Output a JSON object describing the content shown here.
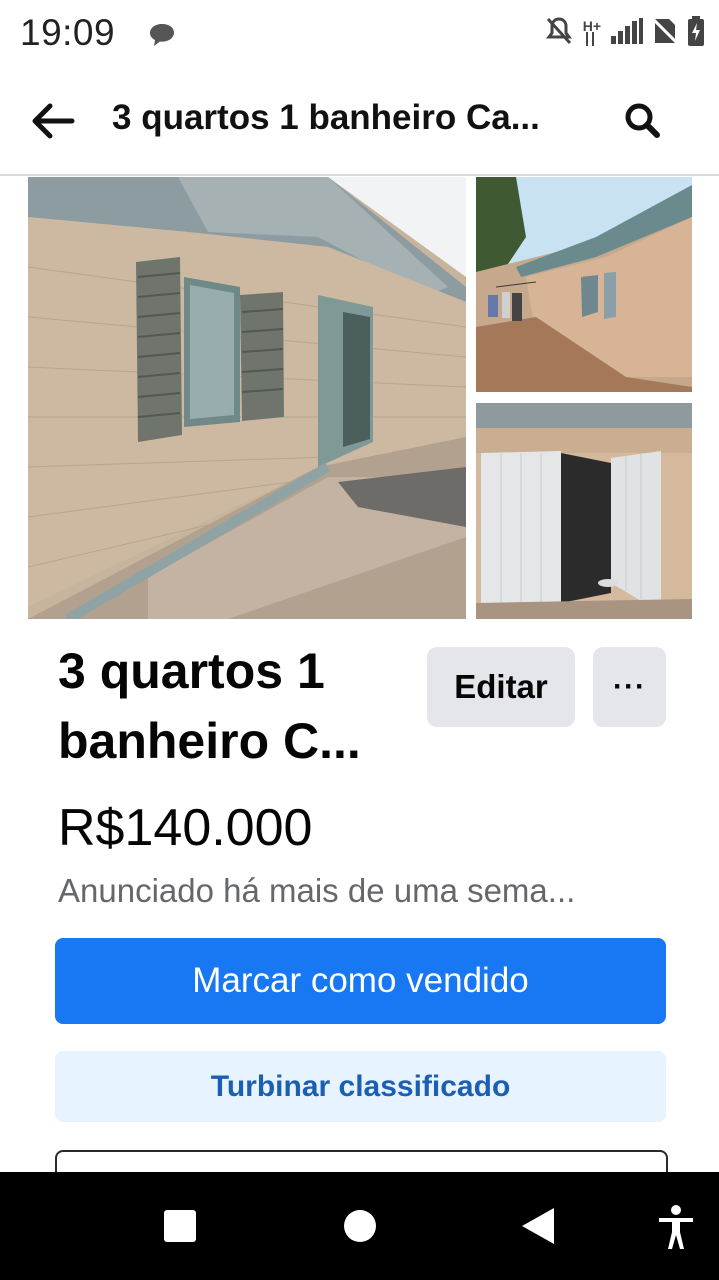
{
  "status_bar": {
    "time": "19:09",
    "icons": [
      "chat-bubble-icon",
      "mute-icon",
      "network-h-plus-icon",
      "signal-icon",
      "no-sim-icon",
      "battery-charging-icon"
    ],
    "network_label": "H+"
  },
  "app_bar": {
    "title": "3 quartos 1 banheiro Ca...",
    "back_icon": "back-arrow-icon",
    "search_icon": "search-icon"
  },
  "listing": {
    "title": "3 quartos 1 banheiro C...",
    "price": "R$140.000",
    "posted": "Anunciado há mais de uma sema...",
    "edit_label": "Editar",
    "more_label": "···",
    "mark_sold_label": "Marcar como vendido",
    "boost_label": "Turbinar classificado"
  },
  "colors": {
    "primary": "#1877f2",
    "boost_bg": "#e7f3ff",
    "boost_text": "#1b5fb5",
    "secondary_button_bg": "#e4e6eb",
    "muted_text": "#65676b"
  },
  "nav_bar": {
    "icons": [
      "recents-square-icon",
      "home-circle-icon",
      "back-triangle-icon",
      "accessibility-icon"
    ]
  }
}
